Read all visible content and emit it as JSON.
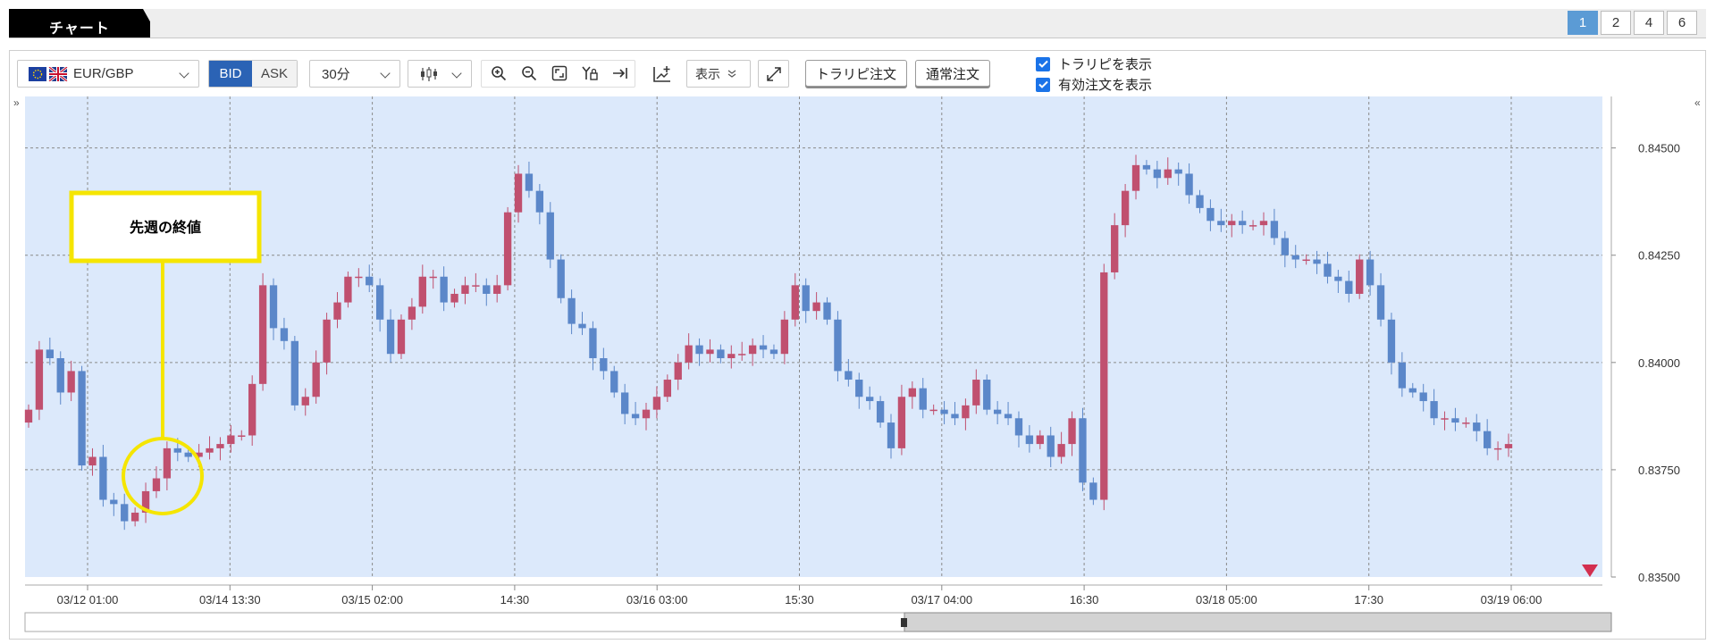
{
  "header": {
    "title": "チャート",
    "pages": [
      "1",
      "2",
      "4",
      "6"
    ],
    "active_page": "1"
  },
  "toolbar": {
    "symbol": "EUR/GBP",
    "bid_label": "BID",
    "ask_label": "ASK",
    "timeframe": "30分",
    "display_label": "表示",
    "trap_order_label": "トラリピ注文",
    "normal_order_label": "通常注文",
    "show_trap_label": "トラリピを表示",
    "show_valid_orders_label": "有効注文を表示",
    "show_trap_checked": true,
    "show_valid_orders_checked": true
  },
  "annotation": {
    "text": "先週の終値",
    "color": "#f5e500"
  },
  "colors": {
    "bg": "#dce9fb",
    "up": "#c0506f",
    "down": "#5b87c9",
    "accent": "#2b63b5",
    "marker": "#d32f4f"
  },
  "chart_data": {
    "type": "candlestick",
    "title": "",
    "symbol": "EUR/GBP",
    "y_ticks": [
      "0.84500",
      "0.84250",
      "0.84000",
      "0.83750",
      "0.83500"
    ],
    "ylim": [
      0.835,
      0.8462
    ],
    "x_ticks": [
      "03/12 01:00",
      "03/14 13:30",
      "03/15 02:00",
      "14:30",
      "03/16 03:00",
      "15:30",
      "03/17 04:00",
      "16:30",
      "03/18 05:00",
      "17:30",
      "03/19 06:00"
    ],
    "series": [
      {
        "values": [
          0.8389,
          0.8403,
          0.8401,
          0.8393,
          0.8398,
          0.8376,
          0.8378,
          0.8368,
          0.8367,
          0.8363,
          0.8365,
          0.837,
          0.8373,
          0.838,
          0.8379,
          0.8378,
          0.8379,
          0.838,
          0.8381,
          0.8383,
          0.8383,
          0.8395,
          0.8418,
          0.8408,
          0.8405,
          0.839,
          0.8392,
          0.84,
          0.841,
          0.8414,
          0.842,
          0.842,
          0.8418,
          0.841,
          0.8402,
          0.841,
          0.8413,
          0.842,
          0.842,
          0.8414,
          0.8416,
          0.8418,
          0.8418,
          0.8416,
          0.8418,
          0.8435,
          0.8444,
          0.844,
          0.8435,
          0.8424,
          0.8415,
          0.8409,
          0.8408,
          0.8401,
          0.8398,
          0.8393,
          0.8388,
          0.8387,
          0.8389,
          0.8392,
          0.8396,
          0.84,
          0.8404,
          0.8402,
          0.8403,
          0.8401,
          0.8402,
          0.8402,
          0.8404,
          0.8403,
          0.8402,
          0.841,
          0.8418,
          0.8412,
          0.8414,
          0.841,
          0.8398,
          0.8396,
          0.8392,
          0.8391,
          0.8386,
          0.838,
          0.8392,
          0.8394,
          0.8389,
          0.8389,
          0.8388,
          0.8387,
          0.839,
          0.8396,
          0.8389,
          0.8388,
          0.8387,
          0.8383,
          0.8381,
          0.8383,
          0.8378,
          0.8381,
          0.8387,
          0.8372,
          0.8368,
          0.8421,
          0.8432,
          0.844,
          0.8446,
          0.8445,
          0.8443,
          0.8445,
          0.8444,
          0.8439,
          0.8436,
          0.8433,
          0.8432,
          0.8433,
          0.8432,
          0.8432,
          0.8433,
          0.8429,
          0.8425,
          0.8424,
          0.8424,
          0.8423,
          0.842,
          0.8419,
          0.8416,
          0.8424,
          0.8418,
          0.841,
          0.84,
          0.8394,
          0.8393,
          0.8391,
          0.8387,
          0.8387,
          0.8386,
          0.8386,
          0.8384,
          0.838,
          0.838,
          0.8381
        ]
      }
    ]
  }
}
